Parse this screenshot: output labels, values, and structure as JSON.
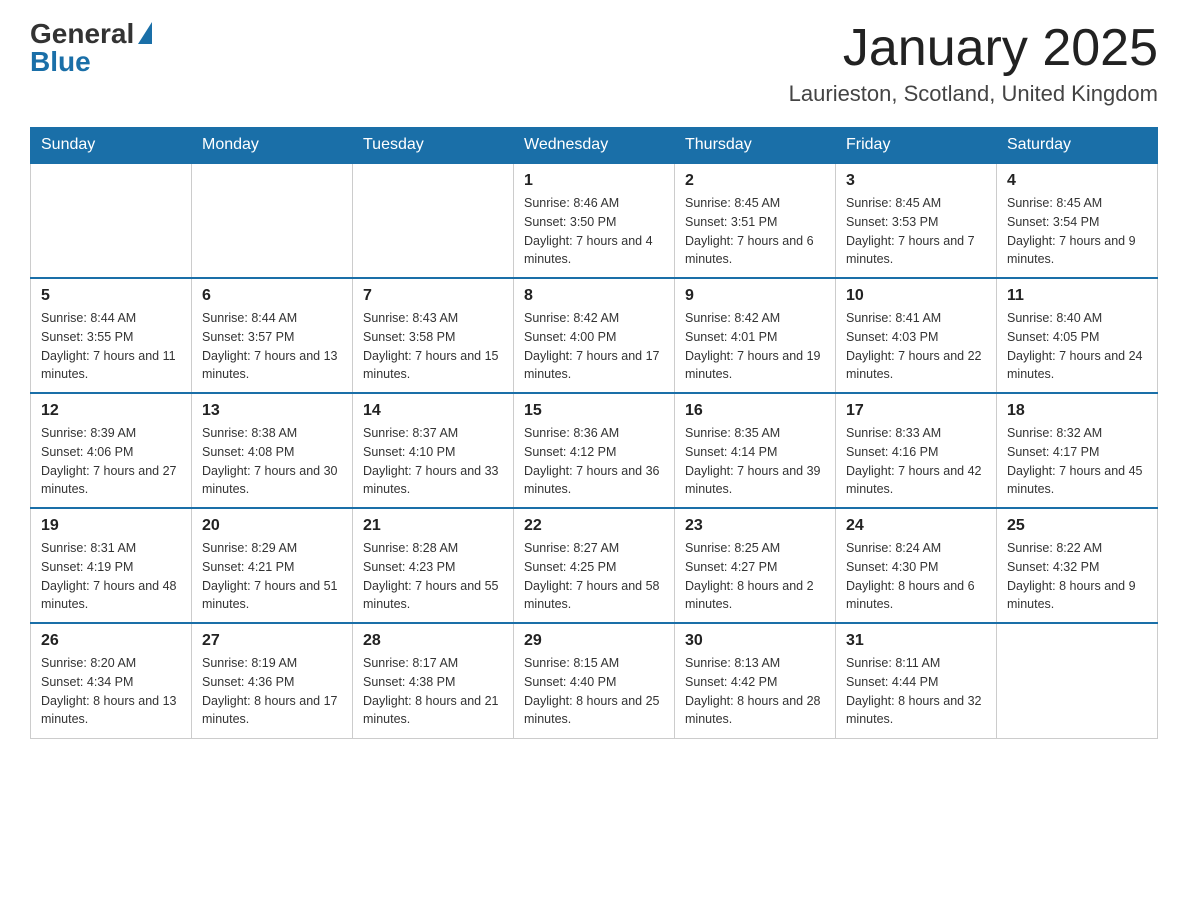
{
  "header": {
    "logo_general": "General",
    "logo_blue": "Blue",
    "title": "January 2025",
    "location": "Laurieston, Scotland, United Kingdom"
  },
  "days_of_week": [
    "Sunday",
    "Monday",
    "Tuesday",
    "Wednesday",
    "Thursday",
    "Friday",
    "Saturday"
  ],
  "weeks": [
    [
      {
        "day": "",
        "info": ""
      },
      {
        "day": "",
        "info": ""
      },
      {
        "day": "",
        "info": ""
      },
      {
        "day": "1",
        "info": "Sunrise: 8:46 AM\nSunset: 3:50 PM\nDaylight: 7 hours and 4 minutes."
      },
      {
        "day": "2",
        "info": "Sunrise: 8:45 AM\nSunset: 3:51 PM\nDaylight: 7 hours and 6 minutes."
      },
      {
        "day": "3",
        "info": "Sunrise: 8:45 AM\nSunset: 3:53 PM\nDaylight: 7 hours and 7 minutes."
      },
      {
        "day": "4",
        "info": "Sunrise: 8:45 AM\nSunset: 3:54 PM\nDaylight: 7 hours and 9 minutes."
      }
    ],
    [
      {
        "day": "5",
        "info": "Sunrise: 8:44 AM\nSunset: 3:55 PM\nDaylight: 7 hours and 11 minutes."
      },
      {
        "day": "6",
        "info": "Sunrise: 8:44 AM\nSunset: 3:57 PM\nDaylight: 7 hours and 13 minutes."
      },
      {
        "day": "7",
        "info": "Sunrise: 8:43 AM\nSunset: 3:58 PM\nDaylight: 7 hours and 15 minutes."
      },
      {
        "day": "8",
        "info": "Sunrise: 8:42 AM\nSunset: 4:00 PM\nDaylight: 7 hours and 17 minutes."
      },
      {
        "day": "9",
        "info": "Sunrise: 8:42 AM\nSunset: 4:01 PM\nDaylight: 7 hours and 19 minutes."
      },
      {
        "day": "10",
        "info": "Sunrise: 8:41 AM\nSunset: 4:03 PM\nDaylight: 7 hours and 22 minutes."
      },
      {
        "day": "11",
        "info": "Sunrise: 8:40 AM\nSunset: 4:05 PM\nDaylight: 7 hours and 24 minutes."
      }
    ],
    [
      {
        "day": "12",
        "info": "Sunrise: 8:39 AM\nSunset: 4:06 PM\nDaylight: 7 hours and 27 minutes."
      },
      {
        "day": "13",
        "info": "Sunrise: 8:38 AM\nSunset: 4:08 PM\nDaylight: 7 hours and 30 minutes."
      },
      {
        "day": "14",
        "info": "Sunrise: 8:37 AM\nSunset: 4:10 PM\nDaylight: 7 hours and 33 minutes."
      },
      {
        "day": "15",
        "info": "Sunrise: 8:36 AM\nSunset: 4:12 PM\nDaylight: 7 hours and 36 minutes."
      },
      {
        "day": "16",
        "info": "Sunrise: 8:35 AM\nSunset: 4:14 PM\nDaylight: 7 hours and 39 minutes."
      },
      {
        "day": "17",
        "info": "Sunrise: 8:33 AM\nSunset: 4:16 PM\nDaylight: 7 hours and 42 minutes."
      },
      {
        "day": "18",
        "info": "Sunrise: 8:32 AM\nSunset: 4:17 PM\nDaylight: 7 hours and 45 minutes."
      }
    ],
    [
      {
        "day": "19",
        "info": "Sunrise: 8:31 AM\nSunset: 4:19 PM\nDaylight: 7 hours and 48 minutes."
      },
      {
        "day": "20",
        "info": "Sunrise: 8:29 AM\nSunset: 4:21 PM\nDaylight: 7 hours and 51 minutes."
      },
      {
        "day": "21",
        "info": "Sunrise: 8:28 AM\nSunset: 4:23 PM\nDaylight: 7 hours and 55 minutes."
      },
      {
        "day": "22",
        "info": "Sunrise: 8:27 AM\nSunset: 4:25 PM\nDaylight: 7 hours and 58 minutes."
      },
      {
        "day": "23",
        "info": "Sunrise: 8:25 AM\nSunset: 4:27 PM\nDaylight: 8 hours and 2 minutes."
      },
      {
        "day": "24",
        "info": "Sunrise: 8:24 AM\nSunset: 4:30 PM\nDaylight: 8 hours and 6 minutes."
      },
      {
        "day": "25",
        "info": "Sunrise: 8:22 AM\nSunset: 4:32 PM\nDaylight: 8 hours and 9 minutes."
      }
    ],
    [
      {
        "day": "26",
        "info": "Sunrise: 8:20 AM\nSunset: 4:34 PM\nDaylight: 8 hours and 13 minutes."
      },
      {
        "day": "27",
        "info": "Sunrise: 8:19 AM\nSunset: 4:36 PM\nDaylight: 8 hours and 17 minutes."
      },
      {
        "day": "28",
        "info": "Sunrise: 8:17 AM\nSunset: 4:38 PM\nDaylight: 8 hours and 21 minutes."
      },
      {
        "day": "29",
        "info": "Sunrise: 8:15 AM\nSunset: 4:40 PM\nDaylight: 8 hours and 25 minutes."
      },
      {
        "day": "30",
        "info": "Sunrise: 8:13 AM\nSunset: 4:42 PM\nDaylight: 8 hours and 28 minutes."
      },
      {
        "day": "31",
        "info": "Sunrise: 8:11 AM\nSunset: 4:44 PM\nDaylight: 8 hours and 32 minutes."
      },
      {
        "day": "",
        "info": ""
      }
    ]
  ]
}
